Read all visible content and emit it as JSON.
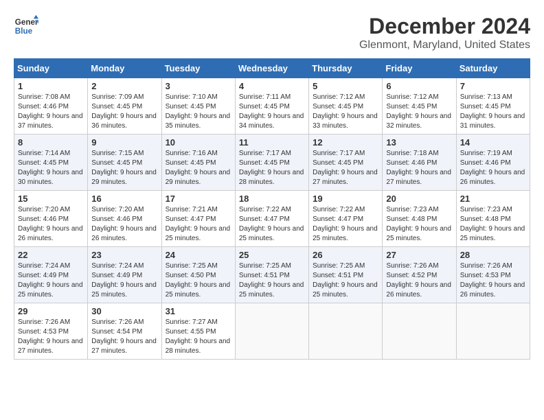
{
  "logo": {
    "line1": "General",
    "line2": "Blue"
  },
  "title": "December 2024",
  "location": "Glenmont, Maryland, United States",
  "days_of_week": [
    "Sunday",
    "Monday",
    "Tuesday",
    "Wednesday",
    "Thursday",
    "Friday",
    "Saturday"
  ],
  "weeks": [
    [
      {
        "day": "1",
        "sunrise": "7:08 AM",
        "sunset": "4:46 PM",
        "daylight": "9 hours and 37 minutes."
      },
      {
        "day": "2",
        "sunrise": "7:09 AM",
        "sunset": "4:45 PM",
        "daylight": "9 hours and 36 minutes."
      },
      {
        "day": "3",
        "sunrise": "7:10 AM",
        "sunset": "4:45 PM",
        "daylight": "9 hours and 35 minutes."
      },
      {
        "day": "4",
        "sunrise": "7:11 AM",
        "sunset": "4:45 PM",
        "daylight": "9 hours and 34 minutes."
      },
      {
        "day": "5",
        "sunrise": "7:12 AM",
        "sunset": "4:45 PM",
        "daylight": "9 hours and 33 minutes."
      },
      {
        "day": "6",
        "sunrise": "7:12 AM",
        "sunset": "4:45 PM",
        "daylight": "9 hours and 32 minutes."
      },
      {
        "day": "7",
        "sunrise": "7:13 AM",
        "sunset": "4:45 PM",
        "daylight": "9 hours and 31 minutes."
      }
    ],
    [
      {
        "day": "8",
        "sunrise": "7:14 AM",
        "sunset": "4:45 PM",
        "daylight": "9 hours and 30 minutes."
      },
      {
        "day": "9",
        "sunrise": "7:15 AM",
        "sunset": "4:45 PM",
        "daylight": "9 hours and 29 minutes."
      },
      {
        "day": "10",
        "sunrise": "7:16 AM",
        "sunset": "4:45 PM",
        "daylight": "9 hours and 29 minutes."
      },
      {
        "day": "11",
        "sunrise": "7:17 AM",
        "sunset": "4:45 PM",
        "daylight": "9 hours and 28 minutes."
      },
      {
        "day": "12",
        "sunrise": "7:17 AM",
        "sunset": "4:45 PM",
        "daylight": "9 hours and 27 minutes."
      },
      {
        "day": "13",
        "sunrise": "7:18 AM",
        "sunset": "4:46 PM",
        "daylight": "9 hours and 27 minutes."
      },
      {
        "day": "14",
        "sunrise": "7:19 AM",
        "sunset": "4:46 PM",
        "daylight": "9 hours and 26 minutes."
      }
    ],
    [
      {
        "day": "15",
        "sunrise": "7:20 AM",
        "sunset": "4:46 PM",
        "daylight": "9 hours and 26 minutes."
      },
      {
        "day": "16",
        "sunrise": "7:20 AM",
        "sunset": "4:46 PM",
        "daylight": "9 hours and 26 minutes."
      },
      {
        "day": "17",
        "sunrise": "7:21 AM",
        "sunset": "4:47 PM",
        "daylight": "9 hours and 25 minutes."
      },
      {
        "day": "18",
        "sunrise": "7:22 AM",
        "sunset": "4:47 PM",
        "daylight": "9 hours and 25 minutes."
      },
      {
        "day": "19",
        "sunrise": "7:22 AM",
        "sunset": "4:47 PM",
        "daylight": "9 hours and 25 minutes."
      },
      {
        "day": "20",
        "sunrise": "7:23 AM",
        "sunset": "4:48 PM",
        "daylight": "9 hours and 25 minutes."
      },
      {
        "day": "21",
        "sunrise": "7:23 AM",
        "sunset": "4:48 PM",
        "daylight": "9 hours and 25 minutes."
      }
    ],
    [
      {
        "day": "22",
        "sunrise": "7:24 AM",
        "sunset": "4:49 PM",
        "daylight": "9 hours and 25 minutes."
      },
      {
        "day": "23",
        "sunrise": "7:24 AM",
        "sunset": "4:49 PM",
        "daylight": "9 hours and 25 minutes."
      },
      {
        "day": "24",
        "sunrise": "7:25 AM",
        "sunset": "4:50 PM",
        "daylight": "9 hours and 25 minutes."
      },
      {
        "day": "25",
        "sunrise": "7:25 AM",
        "sunset": "4:51 PM",
        "daylight": "9 hours and 25 minutes."
      },
      {
        "day": "26",
        "sunrise": "7:25 AM",
        "sunset": "4:51 PM",
        "daylight": "9 hours and 25 minutes."
      },
      {
        "day": "27",
        "sunrise": "7:26 AM",
        "sunset": "4:52 PM",
        "daylight": "9 hours and 26 minutes."
      },
      {
        "day": "28",
        "sunrise": "7:26 AM",
        "sunset": "4:53 PM",
        "daylight": "9 hours and 26 minutes."
      }
    ],
    [
      {
        "day": "29",
        "sunrise": "7:26 AM",
        "sunset": "4:53 PM",
        "daylight": "9 hours and 27 minutes."
      },
      {
        "day": "30",
        "sunrise": "7:26 AM",
        "sunset": "4:54 PM",
        "daylight": "9 hours and 27 minutes."
      },
      {
        "day": "31",
        "sunrise": "7:27 AM",
        "sunset": "4:55 PM",
        "daylight": "9 hours and 28 minutes."
      },
      null,
      null,
      null,
      null
    ]
  ],
  "labels": {
    "sunrise": "Sunrise:",
    "sunset": "Sunset:",
    "daylight": "Daylight:"
  }
}
